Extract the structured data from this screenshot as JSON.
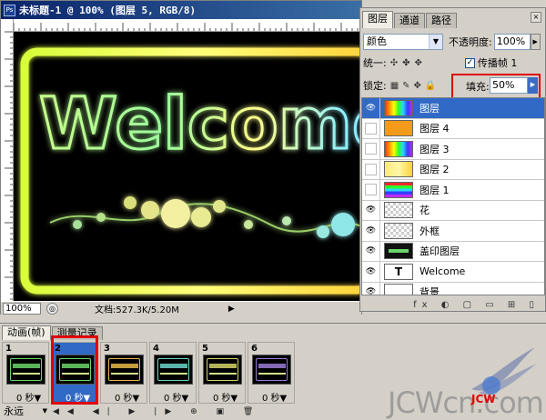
{
  "document": {
    "title": "未标题-1 @ 100% (图层 5, RGB/8)",
    "app_icon": "Ps",
    "canvas_text": "Welcome",
    "status": {
      "zoom": "100%",
      "doc_info": "文档:527.3K/5.20M",
      "arrow": "▶"
    }
  },
  "layers_panel": {
    "tabs": [
      {
        "label": "图层"
      },
      {
        "label": "通道"
      },
      {
        "label": "路径"
      }
    ],
    "close": "×",
    "blend_mode": "颜色",
    "opacity_label": "不透明度:",
    "opacity_value": "100%",
    "unify_label": "统一:",
    "propagate_label": "传播帧 1",
    "propagate_checked": "✓",
    "lock_label": "锁定:",
    "fill_label": "填充:",
    "fill_value": "50%",
    "fill_level": 0.5,
    "layers": [
      {
        "name": "图层",
        "visible": true,
        "selected": true,
        "thumb": "rainbow"
      },
      {
        "name": "图层 4",
        "visible": false,
        "selected": false,
        "thumb": "orange"
      },
      {
        "name": "图层 3",
        "visible": false,
        "selected": false,
        "thumb": "rainbow"
      },
      {
        "name": "图层 2",
        "visible": false,
        "selected": false,
        "thumb": "yellow"
      },
      {
        "name": "图层 1",
        "visible": false,
        "selected": false,
        "thumb": "stripes"
      },
      {
        "name": "花",
        "visible": true,
        "selected": false,
        "thumb": "checker"
      },
      {
        "name": "外框",
        "visible": true,
        "selected": false,
        "thumb": "checker"
      },
      {
        "name": "盖印图层",
        "visible": true,
        "selected": false,
        "thumb": "dark"
      },
      {
        "name": "Welcome",
        "visible": true,
        "selected": false,
        "thumb": "text",
        "thumb_text": "T"
      },
      {
        "name": "背景",
        "visible": true,
        "selected": false,
        "thumb": "white"
      }
    ],
    "footer_icons": "fx ◐ ▢ ▭ ⊞ ▯"
  },
  "animation_panel": {
    "tabs": [
      {
        "label": "动画(帧)"
      },
      {
        "label": "测量记录"
      }
    ],
    "frames": [
      {
        "number": "1",
        "time": "0 秒▼"
      },
      {
        "number": "2",
        "time": "0 秒▼"
      },
      {
        "number": "3",
        "time": "0 秒▼"
      },
      {
        "number": "4",
        "time": "0 秒▼"
      },
      {
        "number": "5",
        "time": "0 秒▼"
      },
      {
        "number": "6",
        "time": "0 秒▼"
      }
    ],
    "selected_frame": 1,
    "loop_label": "永远",
    "transport_icons": "◀◀ ◀| ▶ |▶ ⊕ ▣ 🗑"
  },
  "watermark": {
    "text": "JCWcn.com",
    "red_text": "JCW"
  },
  "colors": {
    "selection": "#3169c6",
    "highlight_red": "#e00000",
    "title_bar": "#0a246a"
  },
  "icons": {
    "eye": "eye-icon",
    "lock_transparent": "checkerboard-icon",
    "lock_paint": "brush-icon",
    "lock_move": "move-icon",
    "lock_all": "lock-icon"
  }
}
